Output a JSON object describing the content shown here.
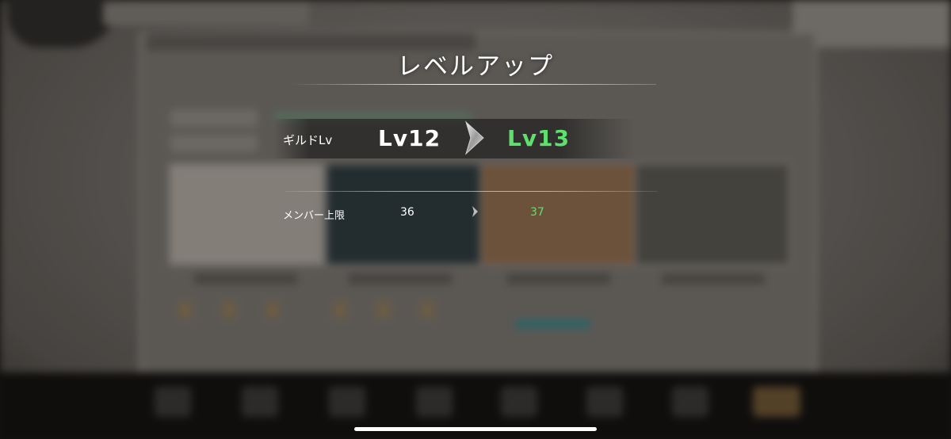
{
  "dialog": {
    "title": "レベルアップ",
    "guild_level": {
      "label": "ギルドLv",
      "old": "Lv12",
      "new": "Lv13"
    },
    "member_limit": {
      "label": "メンバー上限",
      "old": "36",
      "new": "37"
    }
  },
  "colors": {
    "increase": "#5fe06e",
    "text": "#ffffff"
  },
  "icons": [
    "arrow-right-icon",
    "arrow-right-small-icon"
  ]
}
